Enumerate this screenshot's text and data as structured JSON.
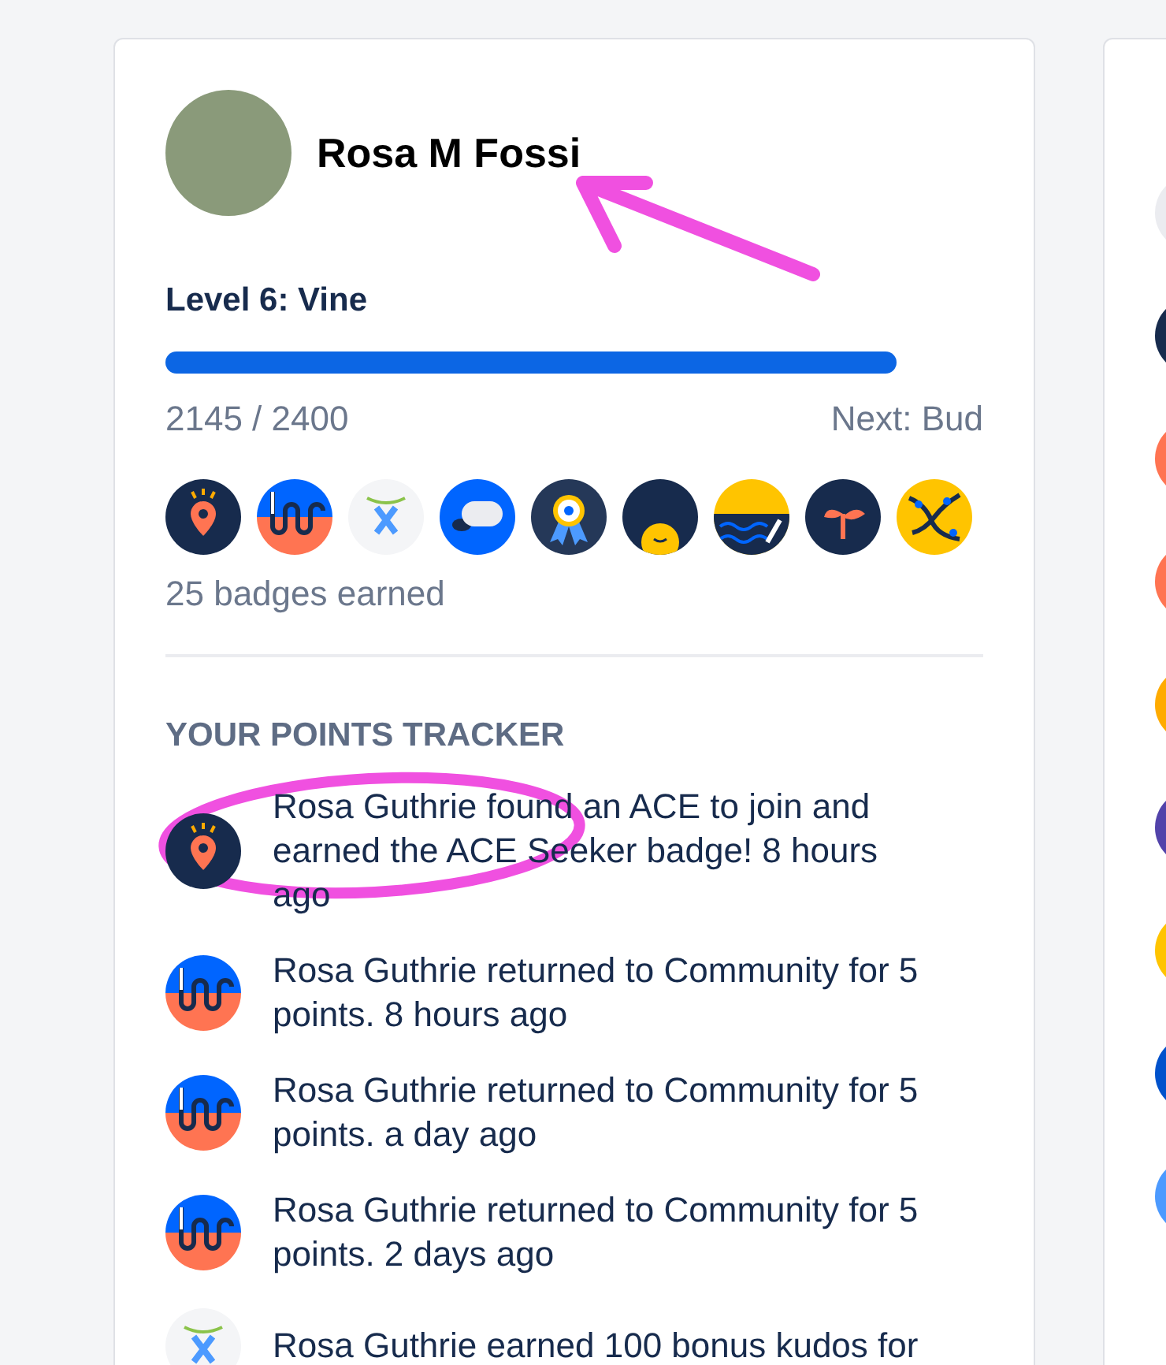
{
  "profile": {
    "name": "Rosa M Fossi"
  },
  "level": {
    "title": "Level 6: Vine",
    "level": 0.894,
    "points": "2145 / 2400",
    "next": "Next: Bud"
  },
  "badges": [
    {
      "kind": "pin"
    },
    {
      "kind": "loops"
    },
    {
      "kind": "logo"
    },
    {
      "kind": "chat"
    },
    {
      "kind": "medal"
    },
    {
      "kind": "face"
    },
    {
      "kind": "waves"
    },
    {
      "kind": "sprout"
    },
    {
      "kind": "vines"
    }
  ],
  "badges_count": "25 badges earned",
  "tracker": {
    "title": "YOUR POINTS TRACKER",
    "items": [
      {
        "kind": "pin",
        "text": "Rosa Guthrie found an ACE to join and earned the ACE Seeker badge! 8 hours ago"
      },
      {
        "kind": "loops",
        "text": "Rosa Guthrie returned to Community for 5 points. 8 hours ago"
      },
      {
        "kind": "loops",
        "text": "Rosa Guthrie returned to Community for 5 points. a day ago"
      },
      {
        "kind": "loops",
        "text": "Rosa Guthrie returned to Community for 5 points. 2 days ago"
      },
      {
        "kind": "logo",
        "text": "Rosa Guthrie earned 100 bonus kudos for"
      }
    ]
  },
  "side_card": {
    "dots": [
      {
        "color": "#ebecf0"
      },
      {
        "color": "#172b4d"
      },
      {
        "color": "#ff7452"
      },
      {
        "color": "#ff7452"
      },
      {
        "color": "#ffab00"
      },
      {
        "color": "#5243aa"
      },
      {
        "color": "#ffc400"
      },
      {
        "color": "#0052cc"
      },
      {
        "color": "#4c9aff"
      }
    ]
  },
  "annotations": {
    "arrow": true,
    "ellipse": true
  }
}
